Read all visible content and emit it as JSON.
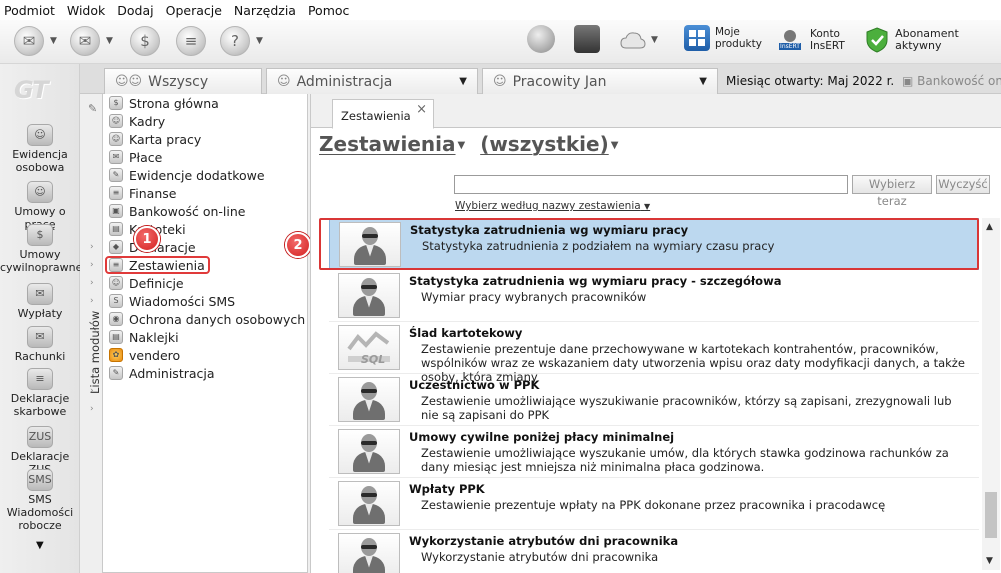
{
  "menu": [
    "Podmiot",
    "Widok",
    "Dodaj",
    "Operacje",
    "Narzędzia",
    "Pomoc"
  ],
  "toolbar": {
    "moje_produkty": [
      "Moje",
      "produkty"
    ],
    "konto_insert": [
      "Konto",
      "InsERT"
    ],
    "abonament": "Abonament aktywny",
    "insert_badge": "InsERT"
  },
  "nav": {
    "logo": "GT",
    "items": [
      {
        "label": "Ewidencja osobowa"
      },
      {
        "label": "Umowy o pracę"
      },
      {
        "label": "Umowy cywilnoprawne"
      },
      {
        "label": "Wypłaty"
      },
      {
        "label": "Rachunki"
      },
      {
        "label": "Deklaracje skarbowe"
      },
      {
        "label": "Deklaracje ZUS"
      },
      {
        "label": "SMS Wiadomości robocze"
      }
    ],
    "more": "▼"
  },
  "tabs": {
    "wszyscy": "Wszyscy",
    "administracja": "Administracja",
    "pracowity": "Pracowity Jan",
    "month_label": "Miesiąc otwarty:",
    "month_value": "Maj 2022 r.",
    "bank": "Bankowość on-l"
  },
  "tree": {
    "vertical_label": "Lista modułów",
    "items": [
      "Strona główna",
      "Kadry",
      "Karta pracy",
      "Płace",
      "Ewidencje dodatkowe",
      "Finanse",
      "Bankowość on-line",
      "Kartoteki",
      "Deklaracje",
      "Zestawienia",
      "Definicje",
      "Wiadomości SMS",
      "Ochrona danych osobowych",
      "Naklejki",
      "vendero",
      "Administracja"
    ]
  },
  "badges": {
    "one": "1",
    "two": "2"
  },
  "content": {
    "doc_tab": "Zestawienia",
    "heading_main": "Zestawienia",
    "heading_filter": "(wszystkie)",
    "search_button": "Wybierz teraz",
    "clear_button": "Wyczyść",
    "choose_by": "Wybierz według nazwy zestawienia",
    "rows": [
      {
        "title": "Statystyka zatrudnienia wg wymiaru pracy",
        "desc": "Statystyka zatrudnienia z podziałem na wymiary czasu pracy"
      },
      {
        "title": "Statystyka zatrudnienia wg wymiaru pracy - szczegółowa",
        "desc": "Wymiar pracy wybranych pracowników"
      },
      {
        "title": "Ślad kartotekowy",
        "desc": "Zestawienie prezentuje dane przechowywane w kartotekach kontrahentów, pracowników, wspólników wraz ze wskazaniem daty utworzenia wpisu oraz daty modyfikacji danych, a także osoby, która zmiany"
      },
      {
        "title": "Uczestnictwo w PPK",
        "desc": "Zestawienie umożliwiające wyszukiwanie pracowników, którzy są zapisani, zrezygnowali lub nie są zapisani do PPK"
      },
      {
        "title": "Umowy cywilne poniżej płacy minimalnej",
        "desc": "Zestawienie umożliwiające wyszukanie umów, dla których stawka godzinowa rachunków za dany miesiąc jest mniejsza niż minimalna płaca godzinowa."
      },
      {
        "title": "Wpłaty PPK",
        "desc": "Zestawienie prezentuje wpłaty na PPK dokonane przez pracownika i pracodawcę"
      },
      {
        "title": "Wykorzystanie atrybutów dni pracownika",
        "desc": "Wykorzystanie atrybutów dni pracownika"
      }
    ],
    "sql_label": "SQL"
  },
  "colors": {
    "selection": "#bcd8ef",
    "highlight": "#d93636",
    "badge": "#d42020"
  }
}
